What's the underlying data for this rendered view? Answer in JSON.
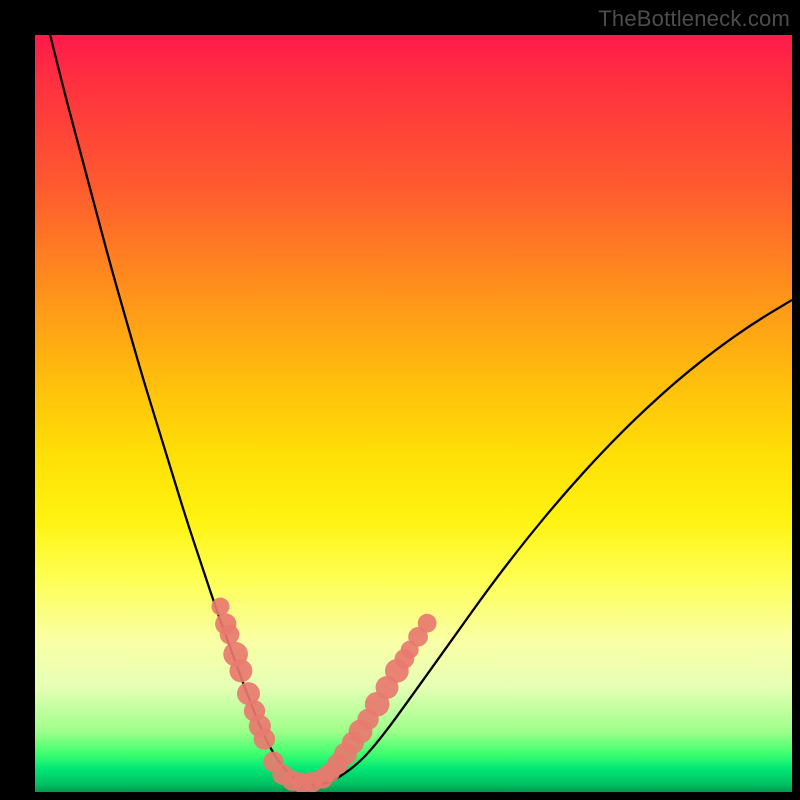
{
  "watermark": "TheBottleneck.com",
  "colors": {
    "frame": "#000000",
    "curve": "#000000",
    "marker": "#e8796f",
    "gradient_stops": [
      "#ff1a4b",
      "#ff3040",
      "#ff5a2f",
      "#ff8a1e",
      "#ffb80e",
      "#ffde06",
      "#fff310",
      "#feff55",
      "#f9ffa5",
      "#e6ffb5",
      "#9eff8a",
      "#3cff6e",
      "#00e676",
      "#00c060",
      "#009850"
    ]
  },
  "chart_data": {
    "type": "line",
    "title": "",
    "xlabel": "",
    "ylabel": "",
    "xlim": [
      0,
      100
    ],
    "ylim": [
      0,
      100
    ],
    "series": [
      {
        "name": "bottleneck-curve",
        "x": [
          0,
          2,
          4,
          6,
          8,
          10,
          12,
          14,
          16,
          18,
          20,
          22,
          24,
          26,
          28,
          30,
          31,
          32,
          33,
          34,
          35,
          36,
          38,
          40,
          43,
          46,
          50,
          55,
          60,
          65,
          70,
          75,
          80,
          85,
          90,
          95,
          100
        ],
        "y": [
          108,
          100,
          92,
          84.5,
          77,
          69.5,
          62.5,
          55.5,
          49,
          42.5,
          36,
          30,
          24,
          18.5,
          13,
          8,
          6,
          4.3,
          3,
          2,
          1.3,
          1,
          1,
          1.8,
          4,
          7.5,
          13,
          20,
          27,
          33.5,
          39.5,
          45,
          50,
          54.5,
          58.5,
          62,
          65
        ]
      }
    ],
    "markers_left": [
      {
        "x": 24.5,
        "y": 24.5,
        "r": 1.2
      },
      {
        "x": 25.2,
        "y": 22.2,
        "r": 1.6
      },
      {
        "x": 25.7,
        "y": 20.8,
        "r": 1.4
      },
      {
        "x": 26.5,
        "y": 18.2,
        "r": 2.0
      },
      {
        "x": 27.2,
        "y": 16.0,
        "r": 1.8
      },
      {
        "x": 28.2,
        "y": 13.0,
        "r": 1.8
      },
      {
        "x": 29.0,
        "y": 10.7,
        "r": 1.6
      },
      {
        "x": 29.7,
        "y": 8.7,
        "r": 1.7
      },
      {
        "x": 30.3,
        "y": 7.0,
        "r": 1.6
      }
    ],
    "markers_bottom": [
      {
        "x": 31.5,
        "y": 4.0,
        "r": 1.5
      },
      {
        "x": 32.7,
        "y": 2.3,
        "r": 1.5
      },
      {
        "x": 34.0,
        "y": 1.5,
        "r": 1.5
      },
      {
        "x": 35.3,
        "y": 1.2,
        "r": 1.5
      },
      {
        "x": 36.6,
        "y": 1.3,
        "r": 1.5
      },
      {
        "x": 38.0,
        "y": 1.8,
        "r": 1.5
      }
    ],
    "markers_right": [
      {
        "x": 39.0,
        "y": 2.6,
        "r": 1.4
      },
      {
        "x": 40.0,
        "y": 3.7,
        "r": 1.6
      },
      {
        "x": 41.0,
        "y": 5.0,
        "r": 1.8
      },
      {
        "x": 42.0,
        "y": 6.5,
        "r": 1.7
      },
      {
        "x": 43.0,
        "y": 8.0,
        "r": 1.9
      },
      {
        "x": 44.0,
        "y": 9.6,
        "r": 1.6
      },
      {
        "x": 45.2,
        "y": 11.6,
        "r": 2.0
      },
      {
        "x": 46.5,
        "y": 13.8,
        "r": 1.8
      },
      {
        "x": 47.8,
        "y": 16.0,
        "r": 1.9
      },
      {
        "x": 48.8,
        "y": 17.6,
        "r": 1.4
      },
      {
        "x": 49.5,
        "y": 18.8,
        "r": 1.2
      },
      {
        "x": 50.6,
        "y": 20.5,
        "r": 1.4
      },
      {
        "x": 51.8,
        "y": 22.3,
        "r": 1.3
      }
    ]
  }
}
